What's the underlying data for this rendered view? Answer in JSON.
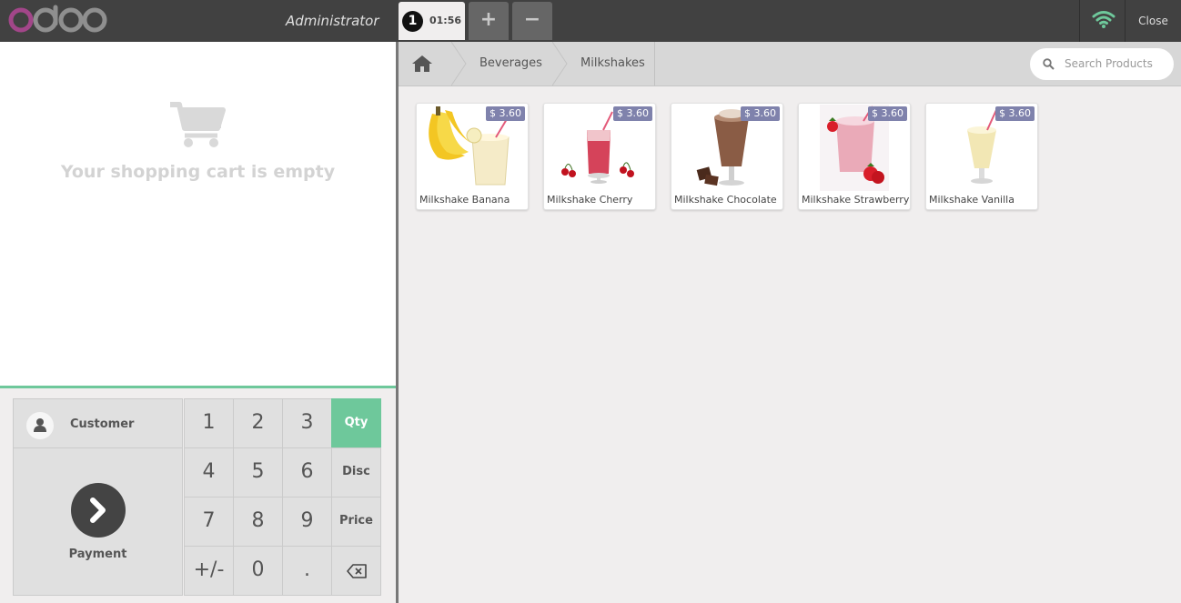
{
  "header": {
    "logo_text": "odoo",
    "user": "Administrator",
    "order": {
      "number": "1",
      "time": "01:56"
    },
    "add_order_symbol": "+",
    "remove_order_symbol": "−",
    "close_label": "Close",
    "icons": {
      "network": "wifi-icon"
    },
    "colors": {
      "logo": "#8f8f8f",
      "logo_accent": "#a24689",
      "wifi": "#6ec89b"
    }
  },
  "cart": {
    "empty_message": "Your shopping cart is empty",
    "icon": "cart-icon"
  },
  "controls": {
    "customer_label": "Customer",
    "payment_label": "Payment",
    "numpad": [
      "1",
      "2",
      "3",
      "4",
      "5",
      "6",
      "7",
      "8",
      "9",
      "+/-",
      "0",
      "."
    ],
    "modes": {
      "qty": "Qty",
      "disc": "Disc",
      "price": "Price"
    },
    "backspace_icon": "backspace-icon",
    "accent": "#6ec89b"
  },
  "products_panel": {
    "breadcrumbs": [
      "Beverages",
      "Milkshakes"
    ],
    "search_placeholder": "Search Products",
    "products": [
      {
        "name": "Milkshake Banana",
        "price": "$ 3.60",
        "color": "#f2e8c6"
      },
      {
        "name": "Milkshake Cherry",
        "price": "$ 3.60",
        "color": "#d5435a"
      },
      {
        "name": "Milkshake Chocolate",
        "price": "$ 3.60",
        "color": "#8a5c45"
      },
      {
        "name": "Milkshake Strawberry",
        "price": "$ 3.60",
        "color": "#eaaab8"
      },
      {
        "name": "Milkshake Vanilla",
        "price": "$ 3.60",
        "color": "#f2e7b4"
      }
    ],
    "price_tag_color": "#7f82ac"
  }
}
